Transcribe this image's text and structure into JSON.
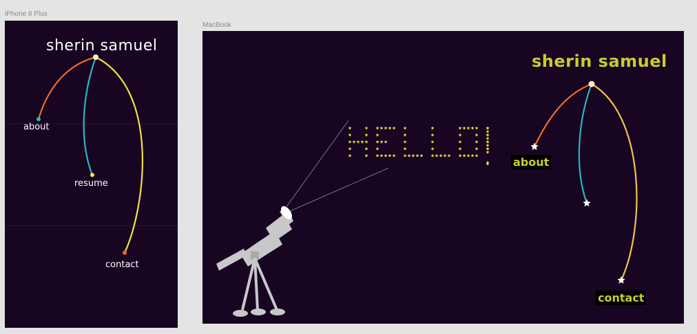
{
  "artboards": {
    "phone": {
      "label": "iPhone 8 Plus",
      "title": "sherin samuel",
      "links": {
        "about": "about",
        "resume": "resume",
        "contact": "contact"
      }
    },
    "mac": {
      "label": "MacBook",
      "title": "sherin samuel",
      "greeting": "HELLO!",
      "links": {
        "about": "about",
        "contact": "contact"
      }
    }
  },
  "colors": {
    "artboard_bg": "#170522",
    "canvas_bg": "#e4e4e4",
    "orange": "#f06a2a",
    "teal": "#27b9c0",
    "yellow": "#f2e537",
    "accent_text": "#c9cc2f"
  },
  "icons": [
    "star-icon",
    "telescope-icon"
  ]
}
